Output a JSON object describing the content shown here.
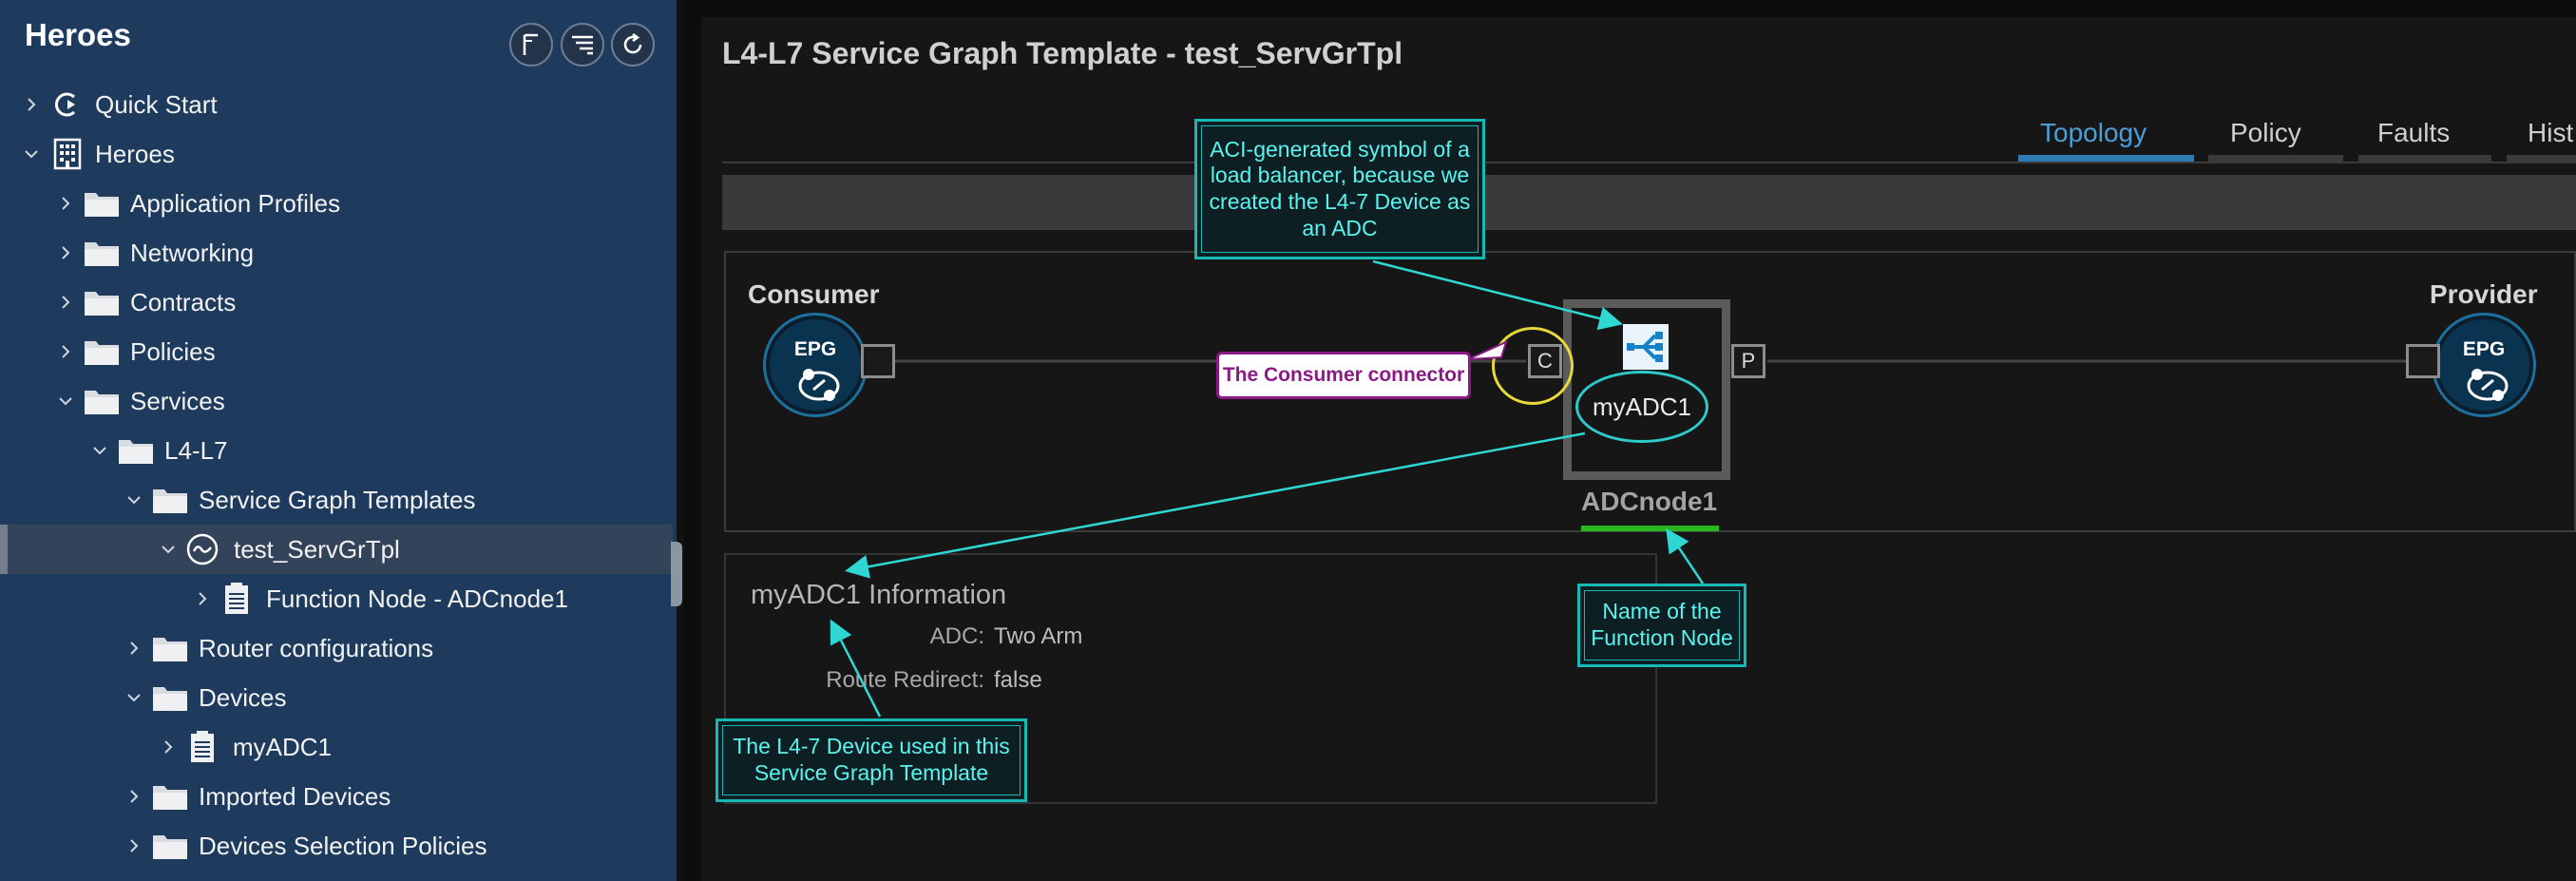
{
  "sidebar": {
    "title": "Heroes",
    "tree": [
      {
        "label": "Quick Start",
        "icon": "quick-start-icon",
        "chevron": "right",
        "name": "quick-start"
      },
      {
        "label": "Heroes",
        "icon": "tenant-building-icon",
        "chevron": "down",
        "name": "heroes"
      },
      {
        "label": "Application Profiles",
        "icon": "folder-icon",
        "chevron": "right",
        "name": "application-profiles"
      },
      {
        "label": "Networking",
        "icon": "folder-icon",
        "chevron": "right",
        "name": "networking"
      },
      {
        "label": "Contracts",
        "icon": "folder-icon",
        "chevron": "right",
        "name": "contracts"
      },
      {
        "label": "Policies",
        "icon": "folder-icon",
        "chevron": "right",
        "name": "policies"
      },
      {
        "label": "Services",
        "icon": "folder-icon",
        "chevron": "down",
        "name": "services"
      },
      {
        "label": "L4-L7",
        "icon": "folder-icon",
        "chevron": "down",
        "name": "l4-l7"
      },
      {
        "label": "Service Graph Templates",
        "icon": "folder-icon",
        "chevron": "down",
        "name": "service-graph-templates"
      },
      {
        "label": "test_ServGrTpl",
        "icon": "service-graph-icon",
        "chevron": "down",
        "name": "test-servgrtpl",
        "selected": true
      },
      {
        "label": "Function Node - ADCnode1",
        "icon": "document-icon",
        "chevron": "right",
        "name": "function-node-adcnode1"
      },
      {
        "label": "Router configurations",
        "icon": "folder-icon",
        "chevron": "right",
        "name": "router-configurations"
      },
      {
        "label": "Devices",
        "icon": "folder-icon",
        "chevron": "down",
        "name": "devices"
      },
      {
        "label": "myADC1",
        "icon": "document-icon",
        "chevron": "right",
        "name": "myadc1"
      },
      {
        "label": "Imported Devices",
        "icon": "folder-icon",
        "chevron": "right",
        "name": "imported-devices"
      },
      {
        "label": "Devices Selection Policies",
        "icon": "folder-icon",
        "chevron": "right",
        "name": "devices-selection-policies"
      }
    ]
  },
  "main": {
    "title": "L4-L7 Service Graph Template - test_ServGrTpl",
    "tabs": [
      {
        "label": "Topology",
        "active": true
      },
      {
        "label": "Policy",
        "active": false
      },
      {
        "label": "Faults",
        "active": false
      },
      {
        "label": "Hist",
        "active": false
      }
    ]
  },
  "graph": {
    "consumer_label": "Consumer",
    "provider_label": "Provider",
    "epg_text": "EPG",
    "consumer_connector": "C",
    "provider_connector": "P",
    "node_device": "myADC1",
    "node_name": "ADCnode1"
  },
  "info": {
    "title": "myADC1 Information",
    "rows": [
      {
        "key": "ADC:",
        "value": "Two Arm"
      },
      {
        "key": "Route Redirect:",
        "value": "false"
      }
    ]
  },
  "annotations": {
    "aci_symbol": "ACI-generated symbol of a load balancer, because we created the L4-7 Device as an ADC",
    "consumer_connector": "The Consumer connector",
    "function_node_name": "Name of the Function Node",
    "l47_device": "The L4-7 Device used in this Service Graph Template"
  },
  "colors": {
    "sidebar_bg": "#1e3b5e",
    "tab_active": "#2f7ab3",
    "callout": "#5af4ef",
    "consumer_callout": "#8b1a86",
    "highlight_yellow": "#e5d83a",
    "underline_green": "#28b71e"
  }
}
